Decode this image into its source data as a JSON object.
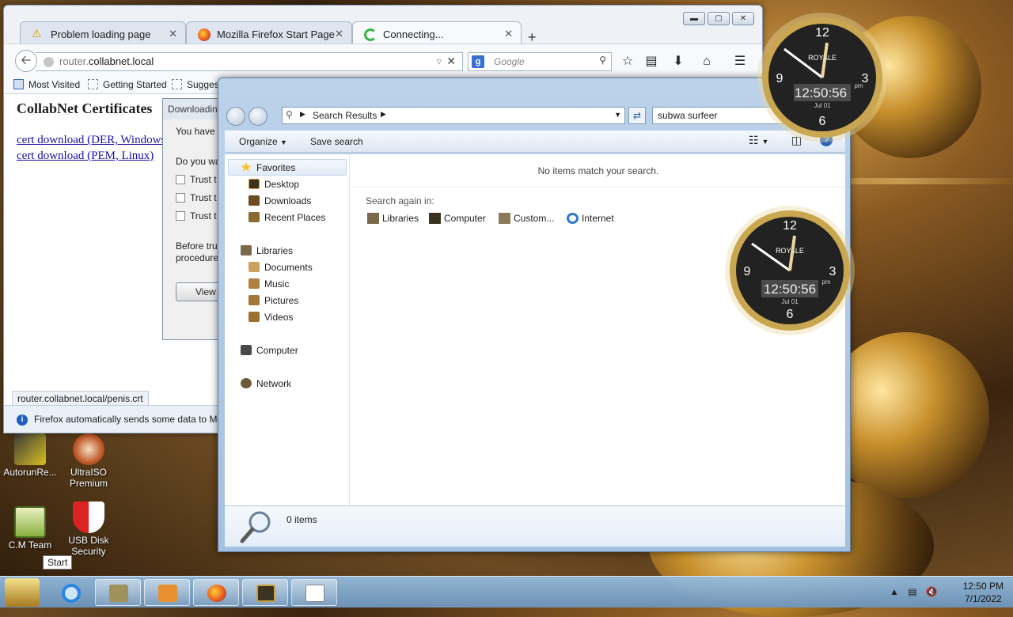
{
  "firefox": {
    "tabs": [
      {
        "label": "Problem loading page"
      },
      {
        "label": "Mozilla Firefox Start Page"
      },
      {
        "label": "Connecting..."
      }
    ],
    "url_host": "router.",
    "url_domain": "collabnet.local",
    "search_placeholder": "Google",
    "bookmarks": [
      "Most Visited",
      "Getting Started",
      "Suggest"
    ],
    "page_title": "CollabNet Certificates",
    "links": [
      "cert download (DER, Windows)",
      "cert download (PEM, Linux)"
    ],
    "status_url": "router.collabnet.local/penis.crt",
    "notice": "Firefox automatically sends some data to Mozilla"
  },
  "download_dialog": {
    "title": "Downloading",
    "line1": "You have",
    "line2": "Do you wa",
    "trust": [
      "Trust t",
      "Trust t",
      "Trust t"
    ],
    "before1": "Before tru",
    "before2": "procedure",
    "view_label": "View"
  },
  "explorer": {
    "breadcrumb": "Search Results",
    "search_value": "subwa surfeer",
    "organize_label": "Organize",
    "save_search_label": "Save search",
    "tree": {
      "favorites": "Favorites",
      "desktop": "Desktop",
      "downloads": "Downloads",
      "recent": "Recent Places",
      "libraries": "Libraries",
      "documents": "Documents",
      "music": "Music",
      "pictures": "Pictures",
      "videos": "Videos",
      "computer": "Computer",
      "network": "Network"
    },
    "no_match": "No items match your search.",
    "search_again": "Search again in:",
    "again": [
      "Libraries",
      "Computer",
      "Custom...",
      "Internet"
    ],
    "item_count": "0 items"
  },
  "clocks": [
    {
      "brand": "ROYALE",
      "time": "12:50:56",
      "ampm": "pm",
      "date": "Jul 01"
    },
    {
      "brand": "ROYALE",
      "time": "12:50:56",
      "ampm": "pm",
      "date": "Jul 01"
    }
  ],
  "desktop_icons": [
    {
      "label": "AutorunRe..."
    },
    {
      "label": "UltraISO Premium"
    },
    {
      "label": "C.M Team"
    },
    {
      "label": "USB Disk Security"
    }
  ],
  "taskbar": {
    "start_tooltip": "Start",
    "time": "12:50 PM",
    "date": "7/1/2022"
  },
  "colors": {
    "link": "#1a0dab",
    "taskbar": "#8cb4d8",
    "explorer_frame": "#a5c0df"
  }
}
